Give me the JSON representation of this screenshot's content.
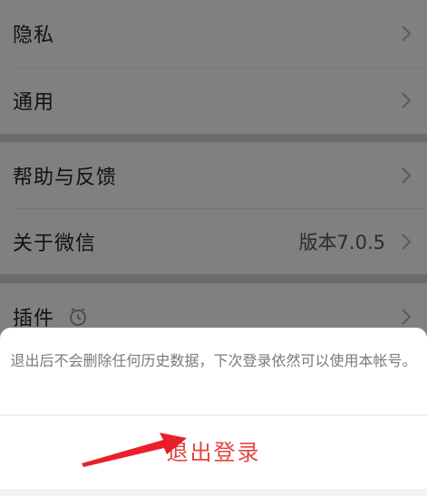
{
  "settings": {
    "items": [
      {
        "label": "隐私"
      },
      {
        "label": "通用"
      },
      {
        "label": "帮助与反馈"
      },
      {
        "label": "关于微信",
        "value": "版本7.0.5"
      },
      {
        "label": "插件"
      }
    ]
  },
  "sheet": {
    "message": "退出后不会删除任何历史数据，下次登录依然可以使用本帐号。",
    "logout_label": "退出登录"
  },
  "colors": {
    "overlay_bg": "#6b6b6b",
    "row_bg": "#808080",
    "logout_red": "#e64340",
    "arrow_red": "#e8202a"
  },
  "icons": {
    "chevron": "chevron-right-icon",
    "plugin": "plugin-timer-icon"
  }
}
